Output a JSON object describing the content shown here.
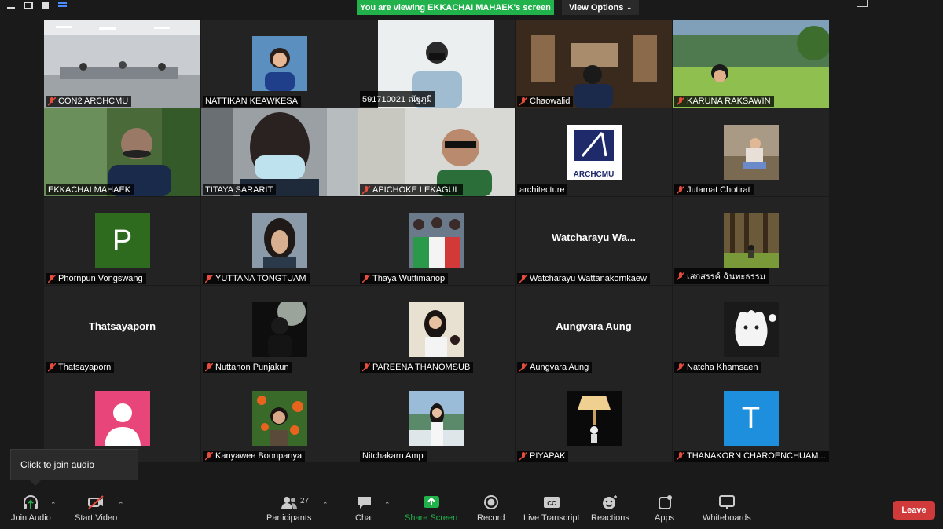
{
  "banner": {
    "text": "You are viewing EKKACHAI MAHAEK's screen"
  },
  "view_options": {
    "label": "View Options"
  },
  "tooltip": {
    "text": "Click to join audio"
  },
  "participants_count": "27",
  "toolbar": {
    "join_audio": "Join Audio",
    "start_video": "Start Video",
    "participants": "Participants",
    "chat": "Chat",
    "share_screen": "Share Screen",
    "record": "Record",
    "live_transcript": "Live Transcript",
    "reactions": "Reactions",
    "apps": "Apps",
    "whiteboards": "Whiteboards",
    "leave": "Leave"
  },
  "colors": {
    "share_green": "#22b24c",
    "active_outline": "#d8e36a",
    "leave_red": "#d13a3a"
  },
  "tiles": [
    {
      "name": "CON2 ARCHCMU",
      "muted": true
    },
    {
      "name": "NATTIKAN KEAWKESA",
      "muted": false
    },
    {
      "name": "591710021 ณัฐภูมิ",
      "muted": false
    },
    {
      "name": "Chaowalid",
      "muted": true
    },
    {
      "name": "KARUNA RAKSAWIN",
      "muted": true
    },
    {
      "name": "EKKACHAI MAHAEK",
      "muted": false,
      "active": true
    },
    {
      "name": "TITAYA SARARIT",
      "muted": false
    },
    {
      "name": "APICHOKE LEKAGUL",
      "muted": true
    },
    {
      "name": "architecture",
      "muted": false,
      "logo_text": "ARCHCMU"
    },
    {
      "name": "Jutamat Chotirat",
      "muted": true
    },
    {
      "name": "Phornpun Vongswang",
      "muted": true,
      "letter": "P"
    },
    {
      "name": "YUTTANA TONGTUAM",
      "muted": true
    },
    {
      "name": "Thaya Wuttimanop",
      "muted": true
    },
    {
      "name": "Watcharayu Wattanakornkaew",
      "muted": true,
      "display": "Watcharayu  Wa..."
    },
    {
      "name": "เสกสรรค์ ฉันทะธรรม",
      "muted": true
    },
    {
      "name": "Thatsayaporn",
      "muted": true,
      "display": "Thatsayaporn"
    },
    {
      "name": "Nuttanon Punjakun",
      "muted": true
    },
    {
      "name": "PAREENA THANOMSUB",
      "muted": true
    },
    {
      "name": "Aungvara Aung",
      "muted": true,
      "display": "Aungvara Aung"
    },
    {
      "name": "Natcha Khamsaen",
      "muted": true
    },
    {
      "name": "",
      "muted": false
    },
    {
      "name": "Kanyawee Boonpanya",
      "muted": true
    },
    {
      "name": "Nitchakarn Amp",
      "muted": false
    },
    {
      "name": "PIYAPAK",
      "muted": true
    },
    {
      "name": "THANAKORN CHAROENCHUAM...",
      "muted": true,
      "letter": "T"
    }
  ]
}
